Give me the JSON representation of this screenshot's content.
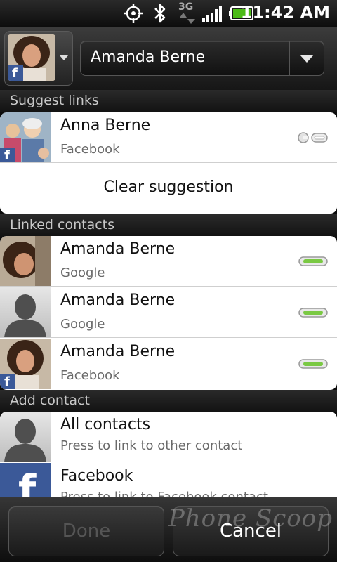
{
  "status_bar": {
    "time": "11:42 AM",
    "network": "3G",
    "icons": [
      "gps-icon",
      "bluetooth-icon",
      "3g-data-icon",
      "signal-icon",
      "battery-icon"
    ]
  },
  "header": {
    "selected_contact": "Amanda Berne",
    "avatar_source_badge": "f"
  },
  "sections": {
    "suggest_links": "Suggest links",
    "linked_contacts": "Linked contacts",
    "add_contact": "Add contact"
  },
  "suggested": {
    "name": "Anna Berne",
    "source": "Facebook",
    "clear_label": "Clear suggestion",
    "badge": "f"
  },
  "linked": [
    {
      "name": "Amanda Berne",
      "source": "Google"
    },
    {
      "name": "Amanda Berne",
      "source": "Google"
    },
    {
      "name": "Amanda Berne",
      "source": "Facebook",
      "badge": "f"
    }
  ],
  "add": [
    {
      "title": "All contacts",
      "subtitle": "Press to link to other contact"
    },
    {
      "title": "Facebook",
      "subtitle": "Press to link to Facebook contact",
      "logo": "f"
    }
  ],
  "buttons": {
    "done": "Done",
    "cancel": "Cancel"
  },
  "watermark": "Phone Scoop",
  "colors": {
    "link_active": "#7ac943",
    "link_inactive": "#d0d0d0",
    "facebook_blue": "#3b5998",
    "disabled_text": "#555555"
  }
}
